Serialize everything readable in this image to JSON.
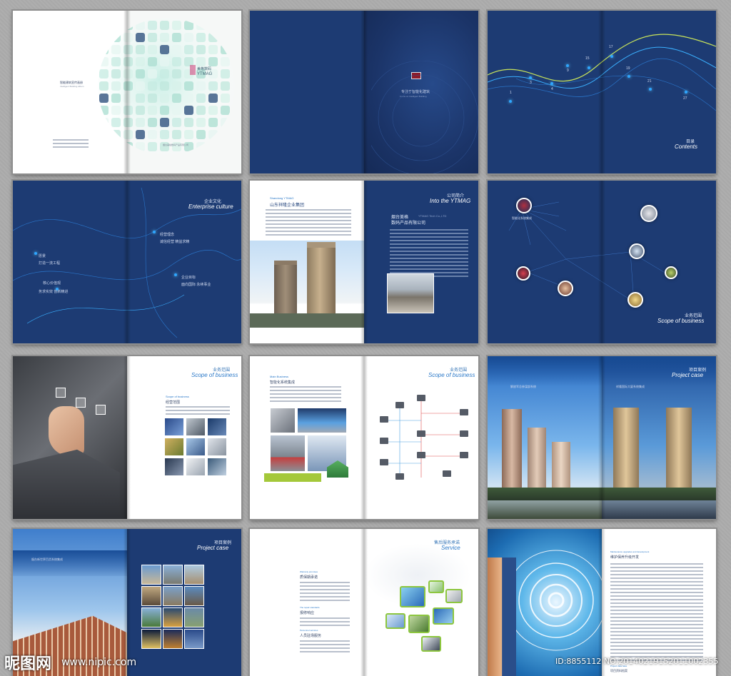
{
  "spreads": {
    "cover": {
      "title_cn": "智能建筑宣传画册",
      "title_en": "Intelligent Building Album",
      "brand_cn": "美格数码",
      "brand_en": "YTMAG",
      "company": "烟台美格数码产品有限公司"
    },
    "inner_cover": {
      "slogan_cn": "专注于智能化建筑",
      "slogan_en": "Focus on Intelligent Building"
    },
    "contents": {
      "title_cn": "目录",
      "title_en": "Contents",
      "numbers": [
        "1",
        "3",
        "4",
        "9",
        "15",
        "17",
        "19",
        "21",
        "27"
      ]
    },
    "culture": {
      "title_cn": "企业文化",
      "title_en": "Enterprise culture",
      "items": [
        "经营理念",
        "诚信经营 精益求精",
        "愿景",
        "打造一流工程",
        "核心价值观",
        "务求实效 创新精进",
        "企业目标",
        "面向国际 永续事业"
      ]
    },
    "intro": {
      "left_title_en": "Shandong YTMAG",
      "left_title_cn": "山东祥隆企业集团",
      "title_cn": "公司简介",
      "title_en": "Into the YTMAG",
      "company_cn_1": "烟台美格",
      "company_cn_2": "数码产品有限公司",
      "company_en": "YTMAG Tech Co.,LTD"
    },
    "business_map": {
      "title_cn": "业务范围",
      "title_en": "Scope of business",
      "center": "智能化系统集成"
    },
    "scope": {
      "title_cn": "业务范围",
      "title_en": "Scope of business",
      "sub_en": "Scope of business",
      "sub_cn": "经营范围"
    },
    "system": {
      "title_cn": "业务范围",
      "title_en": "Scope of business",
      "sub_en": "Main Business",
      "sub_cn": "智能化系统集成"
    },
    "case1": {
      "title_cn": "项目案例",
      "title_en": "Project case",
      "left_cn": "解放军总参谋部系统",
      "right_cn": "祥隆国际大厦系统集成"
    },
    "case2": {
      "title_cn": "项目案例",
      "title_en": "Project case",
      "left_cn": "烟台新世界百货系统集成"
    },
    "service": {
      "title_cn": "售后服务承诺",
      "title_en": "Service",
      "h1_en": "Warranty promises",
      "h1_cn": "质保期承诺",
      "h2_en": "The repair standards",
      "h2_cn": "报修响应",
      "h3_en": "Personnel services",
      "h3_cn": "人员驻场服务"
    },
    "maintenance": {
      "en": "Maintenance upgrades and development",
      "cn": "维护保养升级开发",
      "note_en": "Project data base",
      "note_cn": "项目资料档案",
      "page": "30"
    }
  },
  "watermark": {
    "logo_text": "昵图网",
    "url": "www.nipic.com",
    "id": "ID:8855112 NO:20140219152011002355"
  }
}
